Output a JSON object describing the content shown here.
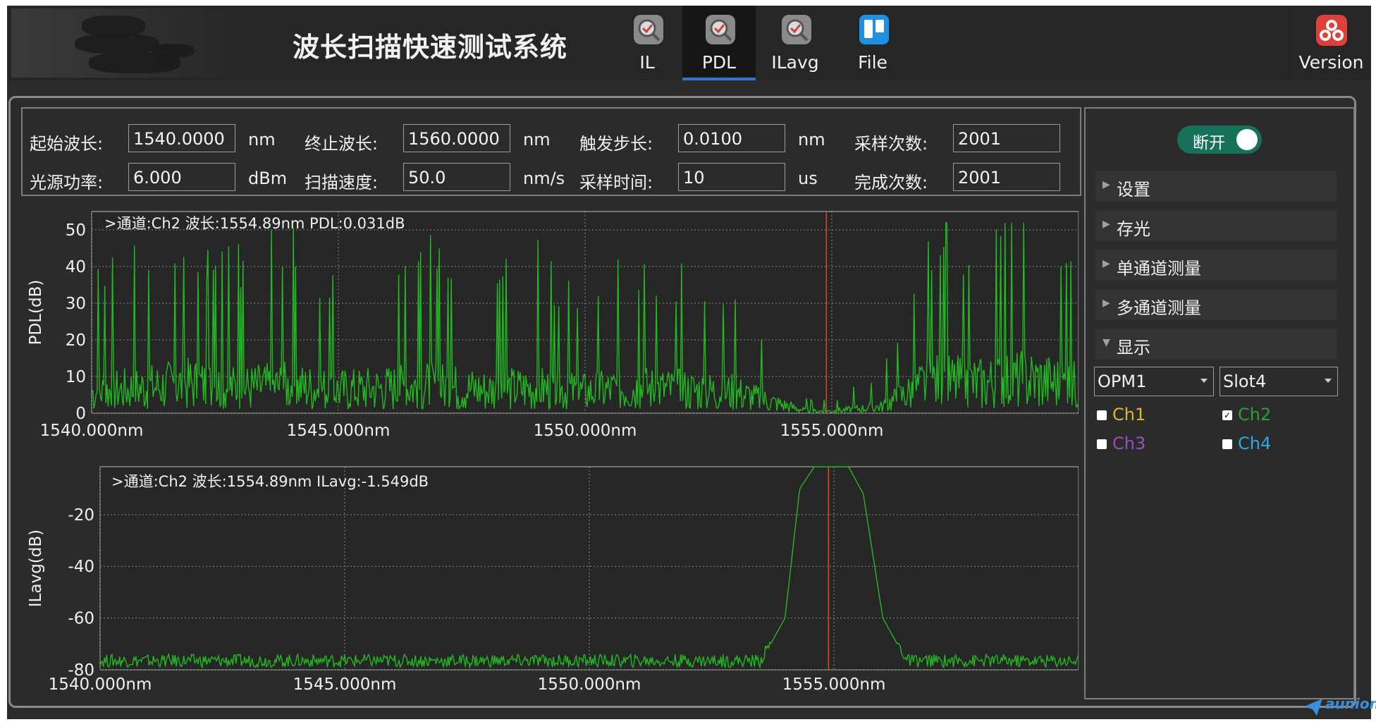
{
  "header": {
    "title": "波长扫描快速测试系统",
    "tabs": [
      {
        "label": "IL",
        "icon": "magnifier-icon",
        "active": false
      },
      {
        "label": "PDL",
        "icon": "magnifier-icon",
        "active": true
      },
      {
        "label": "ILavg",
        "icon": "magnifier-icon",
        "active": false
      },
      {
        "label": "File",
        "icon": "file-icon",
        "active": false
      }
    ],
    "version_label": "Version",
    "version_icon": "version-icon"
  },
  "params": {
    "start_wavelength": {
      "label": "起始波长:",
      "value": "1540.0000",
      "unit": "nm"
    },
    "stop_wavelength": {
      "label": "终止波长:",
      "value": "1560.0000",
      "unit": "nm"
    },
    "trigger_step": {
      "label": "触发步长:",
      "value": "0.0100",
      "unit": "nm"
    },
    "sample_count": {
      "label": "采样次数:",
      "value": "2001"
    },
    "source_power": {
      "label": "光源功率:",
      "value": "6.000",
      "unit": "dBm"
    },
    "scan_speed": {
      "label": "扫描速度:",
      "value": "50.0",
      "unit": "nm/s"
    },
    "sample_time": {
      "label": "采样时间:",
      "value": "10",
      "unit": "us"
    },
    "done_count": {
      "label": "完成次数:",
      "value": "2001"
    }
  },
  "side_panel": {
    "toggle_label": "断开",
    "sections": [
      {
        "label": "设置",
        "expanded": false
      },
      {
        "label": "存光",
        "expanded": false
      },
      {
        "label": "单通道测量",
        "expanded": false
      },
      {
        "label": "多通道测量",
        "expanded": false
      },
      {
        "label": "显示",
        "expanded": true
      }
    ],
    "device_select": "OPM1",
    "slot_select": "Slot4",
    "channels": [
      {
        "label": "Ch1",
        "checked": false,
        "color": "#d9b82a"
      },
      {
        "label": "Ch2",
        "checked": true,
        "color": "#2f9e3a"
      },
      {
        "label": "Ch3",
        "checked": false,
        "color": "#9b4dbf"
      },
      {
        "label": "Ch4",
        "checked": false,
        "color": "#2fa8e0"
      }
    ]
  },
  "chart_data": [
    {
      "type": "line",
      "readout": ">通道:Ch2 波长:1554.89nm PDL:0.031dB",
      "ylabel": "PDL(dB)",
      "xlabel": "",
      "xlim": [
        1540,
        1560
      ],
      "ylim": [
        0,
        55
      ],
      "yticks": [
        0,
        10,
        20,
        30,
        40,
        50
      ],
      "xticks": [
        "1540.000nm",
        "1545.000nm",
        "1550.000nm",
        "1555.000nm"
      ],
      "xtick_values": [
        1540,
        1545,
        1550,
        1555
      ],
      "marker_x": 1554.89,
      "grid": true,
      "series": [
        {
          "name": "Ch2",
          "color": "#22b822",
          "x": [
            1540,
            1541,
            1542,
            1543,
            1544,
            1545,
            1546,
            1547,
            1548,
            1549,
            1550,
            1551,
            1552,
            1553,
            1554,
            1554.5,
            1555,
            1556,
            1557,
            1558,
            1559,
            1560
          ],
          "y": [
            10,
            12,
            14,
            12,
            13,
            11,
            12,
            13,
            11,
            12,
            10,
            12,
            11,
            10,
            4,
            1,
            1,
            3,
            15,
            14,
            16,
            13
          ]
        }
      ]
    },
    {
      "type": "line",
      "readout": ">通道:Ch2 波长:1554.89nm ILavg:-1.549dB",
      "ylabel": "ILavg(dB)",
      "xlabel": "",
      "xlim": [
        1540,
        1560
      ],
      "ylim": [
        -80,
        -1.5
      ],
      "yticks": [
        -20,
        -40,
        -60,
        -80
      ],
      "xticks": [
        "1540.000nm",
        "1545.000nm",
        "1550.000nm",
        "1555.000nm"
      ],
      "xtick_values": [
        1540,
        1545,
        1550,
        1555
      ],
      "marker_x": 1554.89,
      "grid": true,
      "series": [
        {
          "name": "Ch2",
          "color": "#22b822",
          "x": [
            1540,
            1545,
            1550,
            1553.5,
            1554.0,
            1554.3,
            1554.6,
            1555.3,
            1555.6,
            1556.0,
            1556.5,
            1560
          ],
          "y": [
            -77,
            -77,
            -77,
            -77,
            -60,
            -10,
            -1.5,
            -1.5,
            -12,
            -60,
            -77,
            -77
          ]
        }
      ]
    }
  ]
}
